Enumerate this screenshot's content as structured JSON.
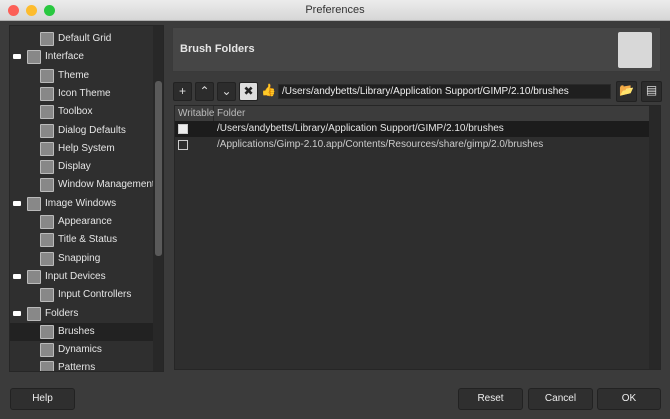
{
  "window": {
    "title": "Preferences"
  },
  "sidebar": {
    "items": [
      {
        "label": "Default Grid",
        "level": 1,
        "icon": "grid-icon"
      },
      {
        "label": "Interface",
        "level": 0,
        "icon": "interface-icon",
        "expanded": true
      },
      {
        "label": "Theme",
        "level": 1,
        "icon": "theme-icon"
      },
      {
        "label": "Icon Theme",
        "level": 1,
        "icon": "icon-theme-icon"
      },
      {
        "label": "Toolbox",
        "level": 1,
        "icon": "toolbox-icon"
      },
      {
        "label": "Dialog Defaults",
        "level": 1,
        "icon": "dialog-defaults-icon"
      },
      {
        "label": "Help System",
        "level": 1,
        "icon": "help-system-icon"
      },
      {
        "label": "Display",
        "level": 1,
        "icon": "display-icon"
      },
      {
        "label": "Window Management",
        "level": 1,
        "icon": "window-management-icon"
      },
      {
        "label": "Image Windows",
        "level": 0,
        "icon": "image-windows-icon",
        "expanded": true
      },
      {
        "label": "Appearance",
        "level": 1,
        "icon": "appearance-icon"
      },
      {
        "label": "Title & Status",
        "level": 1,
        "icon": "title-status-icon"
      },
      {
        "label": "Snapping",
        "level": 1,
        "icon": "snapping-icon"
      },
      {
        "label": "Input Devices",
        "level": 0,
        "icon": "input-devices-icon",
        "expanded": true
      },
      {
        "label": "Input Controllers",
        "level": 1,
        "icon": "input-controllers-icon"
      },
      {
        "label": "Folders",
        "level": 0,
        "icon": "folders-icon",
        "expanded": true
      },
      {
        "label": "Brushes",
        "level": 1,
        "icon": "brushes-folder-icon",
        "selected": true
      },
      {
        "label": "Dynamics",
        "level": 1,
        "icon": "dynamics-folder-icon"
      },
      {
        "label": "Patterns",
        "level": 1,
        "icon": "patterns-folder-icon"
      }
    ]
  },
  "header": {
    "title": "Brush Folders",
    "icon": "brush-folder-icon"
  },
  "toolbar": {
    "path": "/Users/andybetts/Library/Application Support/GIMP/2.10/brushes"
  },
  "table": {
    "columns": [
      "Writable",
      "Folder"
    ],
    "rows": [
      {
        "writable": true,
        "folder": "/Users/andybetts/Library/Application Support/GIMP/2.10/brushes",
        "selected": true
      },
      {
        "writable": false,
        "folder": "/Applications/Gimp-2.10.app/Contents/Resources/share/gimp/2.0/brushes"
      }
    ]
  },
  "buttons": {
    "help": "Help",
    "reset": "Reset",
    "cancel": "Cancel",
    "ok": "OK"
  }
}
